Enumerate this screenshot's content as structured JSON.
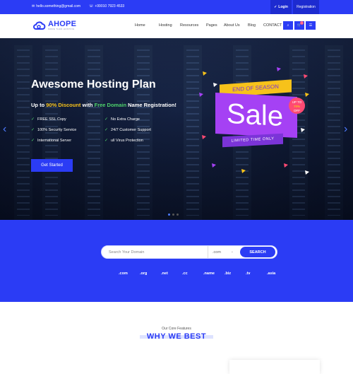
{
  "topbar": {
    "email": "hello.something@gmail.com",
    "phone": "+99010 7923 4533",
    "login_label": "Login",
    "register_label": "Registration"
  },
  "nav": {
    "logo_text": "AHOPE",
    "logo_tagline": "MORE THAN HOSTING",
    "menu": [
      "Home",
      "Hosting",
      "Resources",
      "Pages",
      "About Us",
      "Blog",
      "CONTACT"
    ],
    "icons": [
      "search-icon",
      "cart-icon",
      "menu-icon"
    ],
    "cart_count": "0"
  },
  "hero": {
    "title": "Awesome Hosting Plan",
    "sub_prefix": "Up to ",
    "sub_discount": "90% Discount",
    "sub_mid": " with ",
    "sub_domain": "Free Domain",
    "sub_suffix": " Name Registration!",
    "features": [
      "FREE SSL Copy",
      "No Extra Charge",
      "100% Security Service",
      "24/7 Customer Support",
      "International Server",
      "ull Virus Protection"
    ],
    "cta_label": "Get Started",
    "slide_count": 3,
    "active_slide": 1
  },
  "sale_graphic": {
    "top_text": "END OF SEASON",
    "main_text": "Sale",
    "badge_line1": "UP TO",
    "badge_line2": "70%",
    "badge_line3": "OFF",
    "bottom_text": "LIMITED TIME ONLY"
  },
  "domain_search": {
    "placeholder": "Search Your Domain",
    "tld_selected": ".com",
    "button_label": "SEARCH",
    "tlds": [
      ".com",
      ".org",
      ".net",
      ".cc",
      ".name",
      ".biz",
      ".tv",
      ".asia"
    ]
  },
  "why": {
    "kicker": "Our Core Features",
    "title": "WHY WE BEST"
  },
  "colors": {
    "brand_blue": "#2b3cf5",
    "sale_purple": "#a541f4",
    "sale_yellow": "#f7c21a",
    "accent_green": "#4ed36b"
  }
}
